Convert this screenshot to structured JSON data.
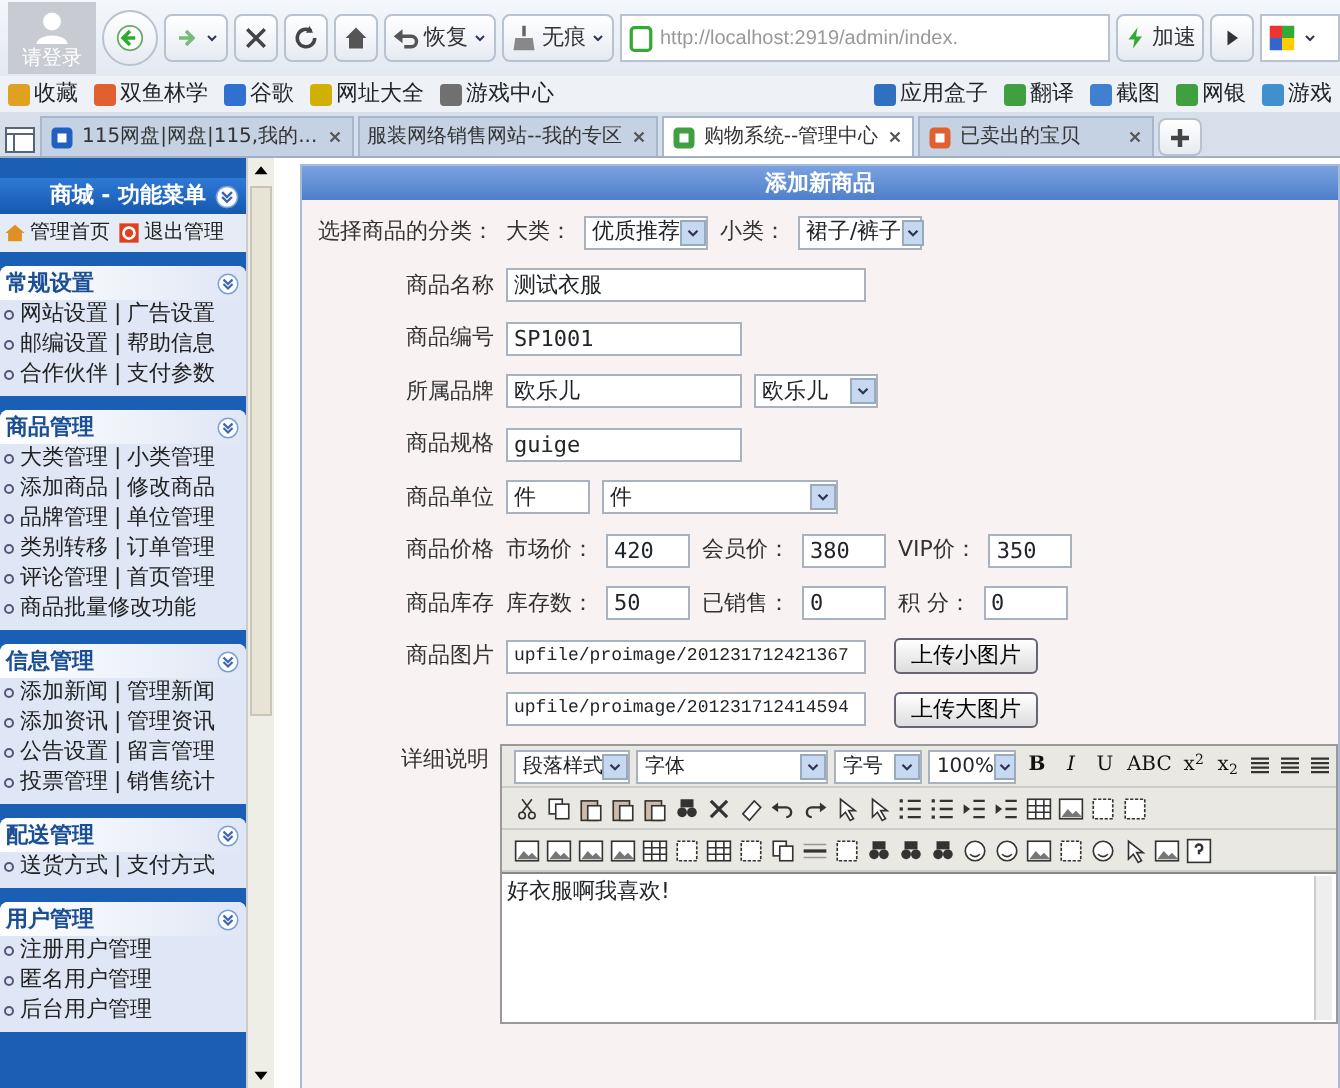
{
  "browser": {
    "avatar_label": "请登录",
    "toolbar_buttons": [
      {
        "kind": "back"
      },
      {
        "kind": "forward"
      },
      {
        "kind": "stop"
      },
      {
        "kind": "refresh"
      },
      {
        "kind": "home"
      },
      {
        "kind": "restore",
        "label": "恢复"
      },
      {
        "kind": "private",
        "label": "无痕"
      }
    ],
    "address": "http://localhost:2919/admin/index.",
    "speedup": "加速",
    "bookmarks_left": [
      {
        "label": "收藏",
        "color": "#e0a020"
      },
      {
        "label": "双鱼林学",
        "color": "#e06030"
      },
      {
        "label": "谷歌",
        "color": "#3070d0"
      },
      {
        "label": "网址大全",
        "color": "#d0b000"
      },
      {
        "label": "游戏中心",
        "color": "#707070"
      }
    ],
    "bookmarks_right": [
      {
        "label": "应用盒子",
        "color": "#3070c0"
      },
      {
        "label": "翻译",
        "color": "#40a040"
      },
      {
        "label": "截图",
        "color": "#4080d0"
      },
      {
        "label": "网银",
        "color": "#40a040"
      },
      {
        "label": "游戏",
        "color": "#4090d0"
      }
    ],
    "tabs": [
      {
        "label": "115网盘|网盘|115,我的...",
        "selected": false,
        "color": "#2060c0"
      },
      {
        "label": "服装网络销售网站--我的专区",
        "selected": false
      },
      {
        "label": "购物系统--管理中心",
        "selected": true,
        "color": "#40a040"
      },
      {
        "label": "已卖出的宝贝",
        "selected": false,
        "color": "#e06030"
      }
    ]
  },
  "sidebar": {
    "title": "商城 - 功能菜单",
    "top_links": [
      "管理首页",
      "退出管理"
    ],
    "sections": [
      {
        "title": "常规设置",
        "rows": [
          [
            "网站设置",
            "广告设置"
          ],
          [
            "邮编设置",
            "帮助信息"
          ],
          [
            "合作伙伴",
            "支付参数"
          ]
        ]
      },
      {
        "title": "商品管理",
        "rows": [
          [
            "大类管理",
            "小类管理"
          ],
          [
            "添加商品",
            "修改商品"
          ],
          [
            "品牌管理",
            "单位管理"
          ],
          [
            "类别转移",
            "订单管理"
          ],
          [
            "评论管理",
            "首页管理"
          ],
          [
            "商品批量修改功能"
          ]
        ]
      },
      {
        "title": "信息管理",
        "rows": [
          [
            "添加新闻",
            "管理新闻"
          ],
          [
            "添加资讯",
            "管理资讯"
          ],
          [
            "公告设置",
            "留言管理"
          ],
          [
            "投票管理",
            "销售统计"
          ]
        ]
      },
      {
        "title": "配送管理",
        "rows": [
          [
            "送货方式",
            "支付方式"
          ]
        ]
      },
      {
        "title": "用户管理",
        "rows": [
          [
            "注册用户管理"
          ],
          [
            "匿名用户管理"
          ],
          [
            "后台用户管理"
          ]
        ]
      }
    ],
    "separator": "|"
  },
  "form": {
    "title": "添加新商品",
    "rows": [
      {
        "label": "选择商品的分类：",
        "items": [
          {
            "kind": "text",
            "value": "大类："
          },
          {
            "kind": "select",
            "value": "优质推荐"
          },
          {
            "kind": "text",
            "value": "小类："
          },
          {
            "kind": "select",
            "value": "裙子/裤子"
          }
        ]
      },
      {
        "label": "商品名称",
        "items": [
          {
            "kind": "input",
            "value": "测试衣服"
          }
        ]
      },
      {
        "label": "商品编号",
        "items": [
          {
            "kind": "input",
            "value": "SP1001"
          }
        ]
      },
      {
        "label": "所属品牌",
        "items": [
          {
            "kind": "input",
            "value": "欧乐儿"
          },
          {
            "kind": "select",
            "value": "欧乐儿"
          }
        ]
      },
      {
        "label": "商品规格",
        "items": [
          {
            "kind": "input",
            "value": "guige"
          }
        ]
      },
      {
        "label": "商品单位",
        "items": [
          {
            "kind": "input",
            "value": "件"
          },
          {
            "kind": "select",
            "value": "件"
          }
        ]
      },
      {
        "label": "商品价格",
        "items": [
          {
            "kind": "text",
            "value": "市场价："
          },
          {
            "kind": "input",
            "value": "420"
          },
          {
            "kind": "text",
            "value": "会员价："
          },
          {
            "kind": "input",
            "value": "380"
          },
          {
            "kind": "text",
            "value": "VIP价："
          },
          {
            "kind": "input",
            "value": "350"
          }
        ]
      },
      {
        "label": "商品库存",
        "items": [
          {
            "kind": "text",
            "value": "库存数："
          },
          {
            "kind": "input",
            "value": "50"
          },
          {
            "kind": "text",
            "value": "已销售："
          },
          {
            "kind": "input",
            "value": "0"
          },
          {
            "kind": "text",
            "value": "积 分："
          },
          {
            "kind": "input",
            "value": "0"
          }
        ]
      },
      {
        "label": "商品图片",
        "items": [
          {
            "kind": "input",
            "value": "upfile/proimage/201231712421367"
          },
          {
            "kind": "button",
            "value": "上传小图片"
          }
        ]
      },
      {
        "items": [
          {
            "kind": "input",
            "value": "upfile/proimage/201231712414594"
          },
          {
            "kind": "button",
            "value": "上传大图片"
          }
        ]
      }
    ],
    "editor": {
      "label": "详细说明",
      "selects": [
        {
          "value": "段落样式"
        },
        {
          "value": "字体"
        },
        {
          "value": "字号"
        },
        {
          "value": "100%"
        }
      ],
      "format_buttons": [
        "**B**",
        "*I*",
        "U",
        "ABC",
        "x$^{2}$",
        "x$_{2}$"
      ],
      "content": "好衣服啊我喜欢!"
    }
  }
}
